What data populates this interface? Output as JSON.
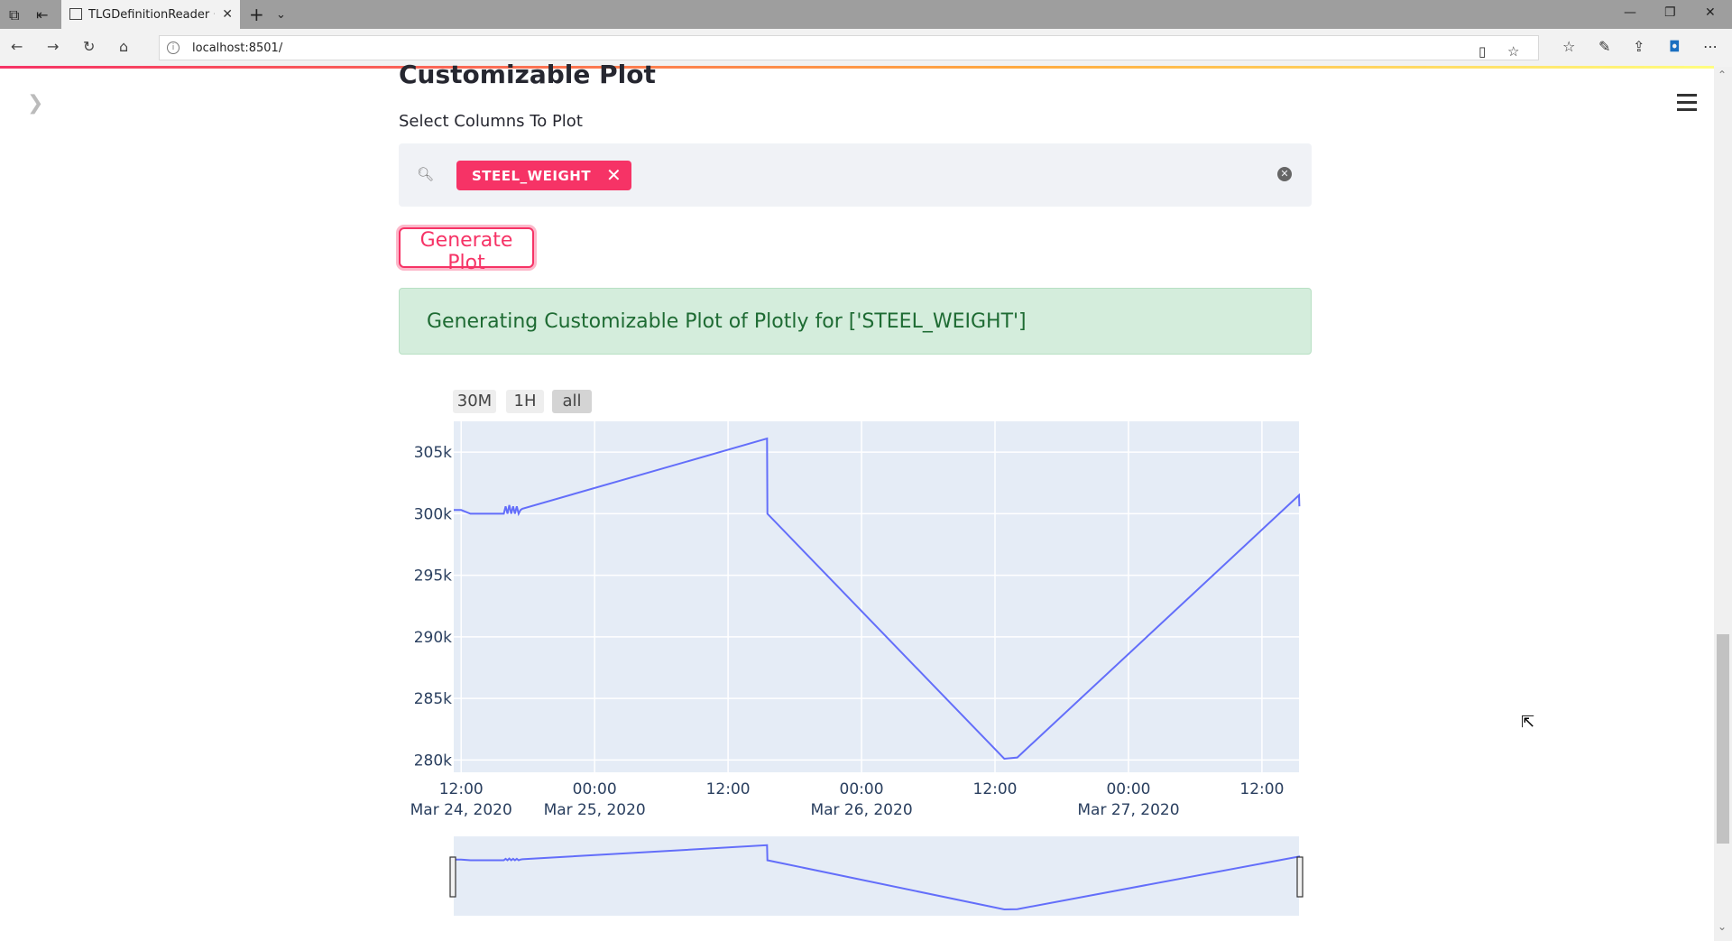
{
  "browser": {
    "tab_title": "TLGDefinitionReader · S",
    "url": "localhost:8501/"
  },
  "page": {
    "title": "Customizable Plot",
    "select_label": "Select Columns To Plot",
    "selected_chips": [
      "STEEL_WEIGHT"
    ],
    "generate_button": "Generate Plot",
    "success_message": "Generating Customizable Plot of Plotly for ['STEEL_WEIGHT']"
  },
  "range_selector": {
    "buttons": [
      "30M",
      "1H",
      "all"
    ],
    "active": "all"
  },
  "colors": {
    "accent": "#f63366",
    "plot_bg": "#e5ecf6",
    "line": "#636efa",
    "success_bg": "#d4eddc",
    "success_text": "#1e6b33"
  },
  "chart_data": {
    "type": "line",
    "title": "",
    "xlabel": "",
    "ylabel": "",
    "x_range": [
      "2020-03-24 11:20",
      "2020-03-27 15:20"
    ],
    "ylim": [
      279000,
      307500
    ],
    "y_ticks": [
      {
        "value": 280000,
        "label": "280k"
      },
      {
        "value": 285000,
        "label": "285k"
      },
      {
        "value": 290000,
        "label": "290k"
      },
      {
        "value": 295000,
        "label": "295k"
      },
      {
        "value": 300000,
        "label": "300k"
      },
      {
        "value": 305000,
        "label": "305k"
      }
    ],
    "x_ticks": [
      {
        "time": "2020-03-24 12:00",
        "label": "12:00",
        "sublabel": "Mar 24, 2020"
      },
      {
        "time": "2020-03-25 00:00",
        "label": "00:00",
        "sublabel": "Mar 25, 2020"
      },
      {
        "time": "2020-03-25 12:00",
        "label": "12:00",
        "sublabel": ""
      },
      {
        "time": "2020-03-26 00:00",
        "label": "00:00",
        "sublabel": "Mar 26, 2020"
      },
      {
        "time": "2020-03-26 12:00",
        "label": "12:00",
        "sublabel": ""
      },
      {
        "time": "2020-03-27 00:00",
        "label": "00:00",
        "sublabel": "Mar 27, 2020"
      },
      {
        "time": "2020-03-27 12:00",
        "label": "12:00",
        "sublabel": ""
      }
    ],
    "series": [
      {
        "points": [
          [
            "2020-03-24 11:20",
            300300
          ],
          [
            "2020-03-24 12:00",
            300300
          ],
          [
            "2020-03-24 12:50",
            300000
          ],
          [
            "2020-03-24 15:50",
            300000
          ],
          [
            "2020-03-24 16:00",
            300600
          ],
          [
            "2020-03-24 16:10",
            300000
          ],
          [
            "2020-03-24 16:20",
            300700
          ],
          [
            "2020-03-24 16:30",
            300000
          ],
          [
            "2020-03-24 16:40",
            300600
          ],
          [
            "2020-03-24 16:50",
            300000
          ],
          [
            "2020-03-24 17:00",
            300600
          ],
          [
            "2020-03-24 17:10",
            300000
          ],
          [
            "2020-03-24 17:20",
            300300
          ],
          [
            "2020-03-24 17:30",
            300400
          ],
          [
            "2020-03-25 15:30",
            306100
          ],
          [
            "2020-03-25 15:32",
            300000
          ],
          [
            "2020-03-26 12:50",
            280100
          ],
          [
            "2020-03-26 14:00",
            280200
          ],
          [
            "2020-03-27 15:20",
            301500
          ],
          [
            "2020-03-27 15:22",
            300600
          ]
        ]
      }
    ]
  }
}
